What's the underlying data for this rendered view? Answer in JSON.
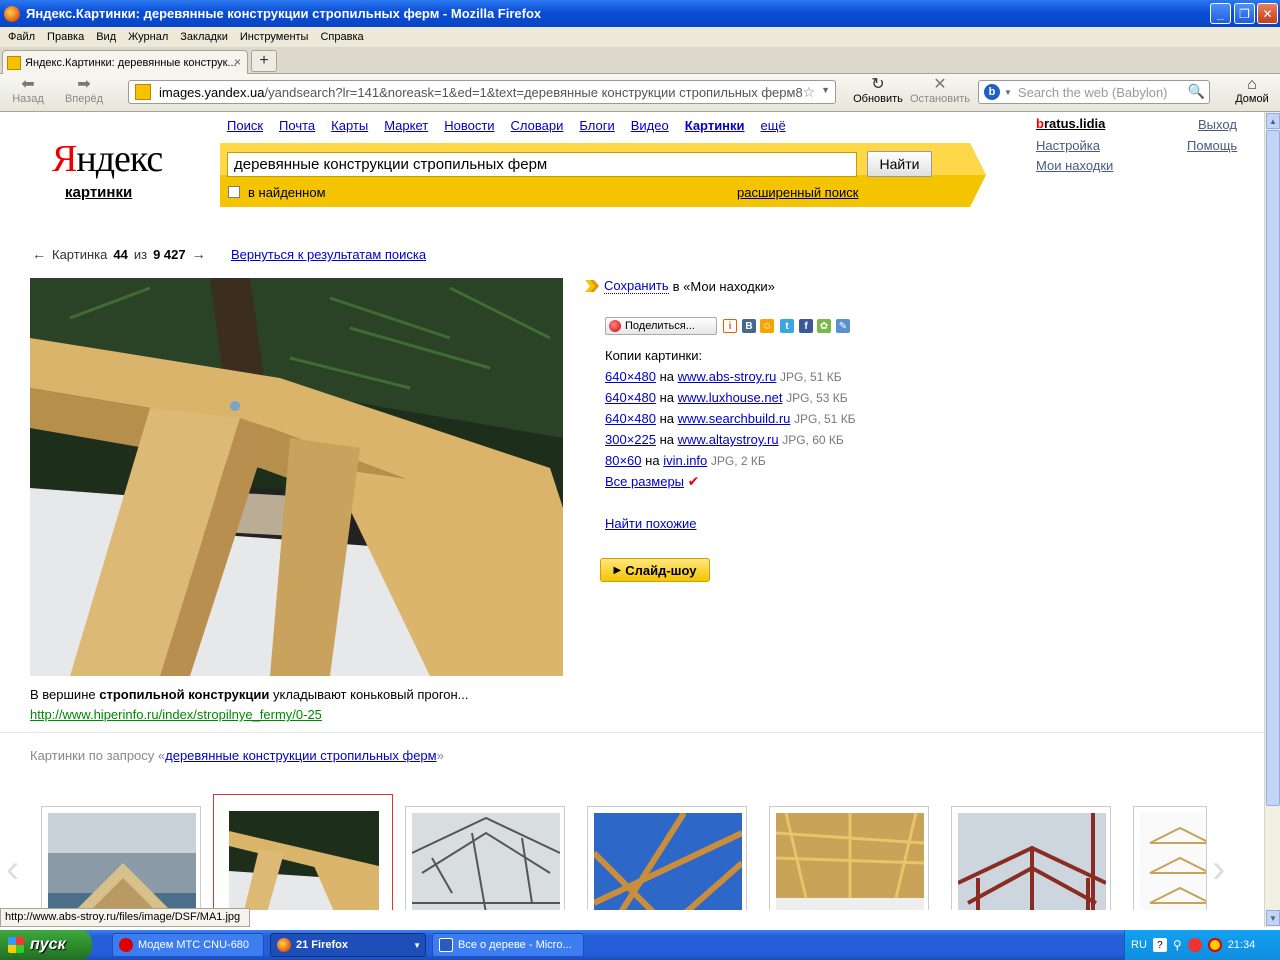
{
  "window": {
    "title": "Яндекс.Картинки: деревянные конструкции стропильных ферм - Mozilla Firefox"
  },
  "menu": [
    "Файл",
    "Правка",
    "Вид",
    "Журнал",
    "Закладки",
    "Инструменты",
    "Справка"
  ],
  "tab": {
    "label": "Яндекс.Картинки: деревянные конструк...",
    "close": "×",
    "new_tab": "+"
  },
  "nav": {
    "back": "Назад",
    "forward": "Вперёд",
    "reload": "Обновить",
    "stop": "Остановить",
    "home": "Домой",
    "url_host": "images.yandex.ua",
    "url_rest": "/yandsearch?lr=141&noreask=1&ed=1&text=деревянные конструкции стропильных ферм8",
    "search_placeholder": "Search the web (Babylon)"
  },
  "yandex": {
    "logo_first": "Я",
    "logo_rest": "ндекс",
    "logo_sub": "картинки",
    "services": [
      "Поиск",
      "Почта",
      "Карты",
      "Маркет",
      "Новости",
      "Словари",
      "Блоги",
      "Видео",
      "Картинки",
      "ещё"
    ],
    "active_service": "Картинки",
    "query": "деревянные конструкции стропильных ферм",
    "find_button": "Найти",
    "in_found": "в найденном",
    "advanced": "расширенный поиск",
    "user_first": "b",
    "user_rest": "ratus.lidia",
    "settings": "Настройка",
    "my_finds": "Мои находки",
    "logout": "Выход",
    "help": "Помощь"
  },
  "picture": {
    "prev_arrow": "←",
    "next_arrow": "→",
    "label": "Картинка",
    "index": "44",
    "of": "из",
    "total": "9 427",
    "back_to_results": "Вернуться к результатам поиска",
    "caption_pre": "В вершине ",
    "caption_bold": "стропильной конструкции",
    "caption_post": " укладывают коньковый прогон...",
    "source_url": "http://www.hiperinfo.ru/index/stropilnye_fermy/0-25"
  },
  "actions": {
    "save": "Сохранить",
    "save_target": "в «Мои находки»",
    "share": "Поделиться...",
    "copies_title": "Копии картинки:",
    "copies": [
      {
        "size": "640×480",
        "on": "на",
        "site": "www.abs-stroy.ru",
        "meta": "JPG, 51 КБ"
      },
      {
        "size": "640×480",
        "on": "на",
        "site": "www.luxhouse.net",
        "meta": "JPG, 53 КБ"
      },
      {
        "size": "640×480",
        "on": "на",
        "site": "www.searchbuild.ru",
        "meta": "JPG, 51 КБ"
      },
      {
        "size": "300×225",
        "on": "на",
        "site": "www.altaystroy.ru",
        "meta": "JPG, 60 КБ"
      },
      {
        "size": "80×60",
        "on": "на",
        "site": "ivin.info",
        "meta": "JPG, 2 КБ"
      }
    ],
    "all_sizes": "Все размеры",
    "find_similar": "Найти похожие",
    "slideshow": "Слайд-шоу"
  },
  "related": {
    "prefix": "Картинки по запросу «",
    "query": "деревянные конструкции стропильных ферм",
    "suffix": "»"
  },
  "status_bar": "http://www.abs-stroy.ru/files/image/DSF/MA1.jpg",
  "taskbar": {
    "start": "пуск",
    "tasks": [
      "Модем МТС CNU-680",
      "21 Firefox",
      "Все о дереве - Micro..."
    ],
    "lang": "RU",
    "clock": "21:34"
  },
  "colors": {
    "title_blue": "#0a4ed6",
    "yandex_red": "#ee0000",
    "link": "#0000cc",
    "source_green": "#008800",
    "yandex_yellow": "#f5c400"
  }
}
